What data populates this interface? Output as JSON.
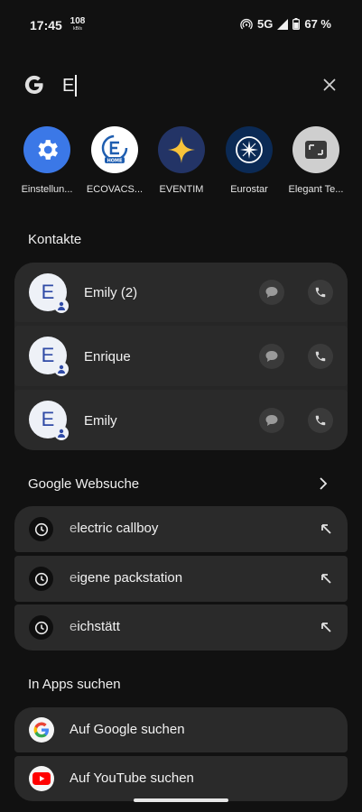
{
  "status_bar": {
    "time": "17:45",
    "net_speed_value": "108",
    "net_speed_unit": "kB/s",
    "network": "5G",
    "battery": "67 %"
  },
  "search": {
    "query": "E",
    "google_logo": "google-g-icon",
    "clear_icon": "close-icon"
  },
  "apps": [
    {
      "label": "Einstellun...",
      "icon": "settings-gear-icon",
      "color": "#3b78e7"
    },
    {
      "label": "ECOVACS...",
      "icon": "ecovacs-home-icon",
      "badge": "HOME",
      "color": "#1f5eb0"
    },
    {
      "label": "EVENTIM",
      "icon": "eventim-star-icon",
      "color": "#233466"
    },
    {
      "label": "Eurostar",
      "icon": "eurostar-icon",
      "color": "#0b2a55"
    },
    {
      "label": "Elegant Te...",
      "icon": "elegant-text-icon",
      "color": "#cfcfcf"
    }
  ],
  "contacts": {
    "title": "Kontakte",
    "items": [
      {
        "initial": "E",
        "name": "Emily (2)"
      },
      {
        "initial": "E",
        "name": "Enrique"
      },
      {
        "initial": "E",
        "name": "Emily"
      }
    ]
  },
  "web_search": {
    "title": "Google Websuche",
    "items": [
      {
        "prefix": "e",
        "rest": "lectric callboy"
      },
      {
        "prefix": "e",
        "rest": "igene packstation"
      },
      {
        "prefix": "e",
        "rest": "ichstätt"
      }
    ]
  },
  "in_apps": {
    "title": "In Apps suchen",
    "items": [
      {
        "label": "Auf Google suchen",
        "icon": "google-g-icon"
      },
      {
        "label": "Auf YouTube suchen",
        "icon": "youtube-icon"
      }
    ]
  },
  "colors": {
    "background": "#111111",
    "card": "#2a2a2a",
    "accent_blue": "#2f4aa6",
    "youtube_red": "#ff0000"
  }
}
